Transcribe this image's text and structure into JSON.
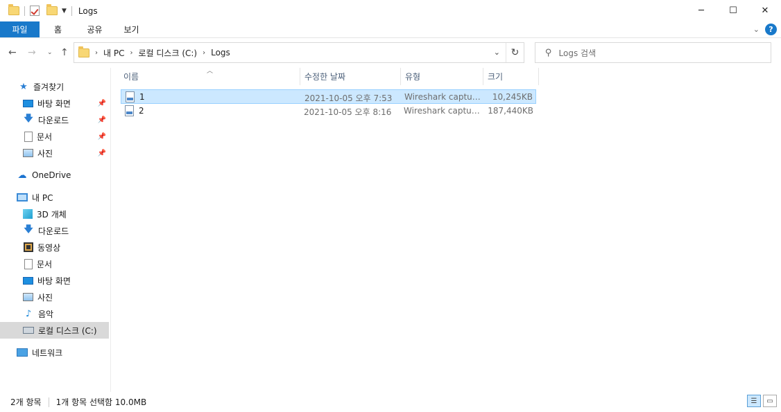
{
  "window": {
    "title": "Logs"
  },
  "ribbon": {
    "tabs": [
      "파일",
      "홈",
      "공유",
      "보기"
    ]
  },
  "address": {
    "crumbs": [
      "내 PC",
      "로컬 디스크 (C:)",
      "Logs"
    ]
  },
  "search": {
    "placeholder": "Logs 검색"
  },
  "sidebar": {
    "items": [
      {
        "label": "즐겨찾기",
        "icon": "star-icon"
      },
      {
        "label": "바탕 화면",
        "icon": "desktop-icon",
        "pinned": true
      },
      {
        "label": "다운로드",
        "icon": "download-icon",
        "pinned": true
      },
      {
        "label": "문서",
        "icon": "document-icon",
        "pinned": true
      },
      {
        "label": "사진",
        "icon": "pictures-icon",
        "pinned": true
      },
      {
        "label": "OneDrive",
        "icon": "cloud-icon"
      },
      {
        "label": "내 PC",
        "icon": "pc-icon"
      },
      {
        "label": "3D 개체",
        "icon": "3d-objects-icon"
      },
      {
        "label": "다운로드",
        "icon": "download-icon"
      },
      {
        "label": "동영상",
        "icon": "video-icon"
      },
      {
        "label": "문서",
        "icon": "document-icon"
      },
      {
        "label": "바탕 화면",
        "icon": "desktop-icon"
      },
      {
        "label": "사진",
        "icon": "pictures-icon"
      },
      {
        "label": "음악",
        "icon": "music-icon"
      },
      {
        "label": "로컬 디스크 (C:)",
        "icon": "drive-icon",
        "selected": true
      },
      {
        "label": "네트워크",
        "icon": "network-icon"
      }
    ]
  },
  "columns": [
    "이름",
    "수정한 날짜",
    "유형",
    "크기"
  ],
  "files": [
    {
      "name": "1",
      "modified": "2021-10-05 오후 7:53",
      "type": "Wireshark capture...",
      "size": "10,245KB",
      "selected": true
    },
    {
      "name": "2",
      "modified": "2021-10-05 오후 8:16",
      "type": "Wireshark capture...",
      "size": "187,440KB",
      "selected": false
    }
  ],
  "status": {
    "count": "2개 항목",
    "selection": "1개 항목 선택함 10.0MB"
  }
}
